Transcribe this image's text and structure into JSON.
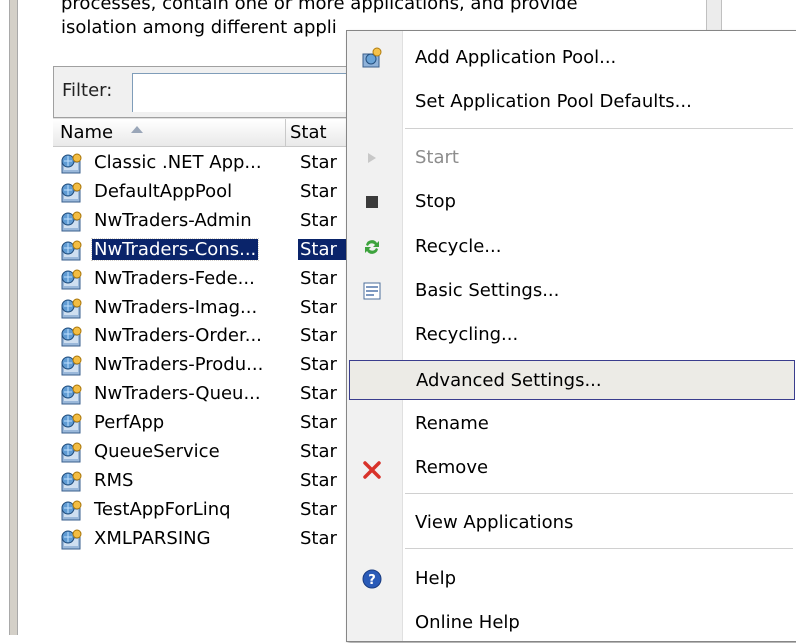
{
  "description": {
    "line1": "processes, contain one or more applications, and provide",
    "line2": "isolation among different appli"
  },
  "filter": {
    "label": "Filter:",
    "value": ""
  },
  "columns": {
    "name": "Name",
    "status": "Stat"
  },
  "pools": [
    {
      "name": "Classic .NET App...",
      "status": "Star"
    },
    {
      "name": "DefaultAppPool",
      "status": "Star"
    },
    {
      "name": "NwTraders-Admin",
      "status": "Star"
    },
    {
      "name": "NwTraders-Cons...",
      "status": "Star"
    },
    {
      "name": "NwTraders-Fede...",
      "status": "Star"
    },
    {
      "name": "NwTraders-Imag...",
      "status": "Star"
    },
    {
      "name": "NwTraders-Order...",
      "status": "Star"
    },
    {
      "name": "NwTraders-Produ...",
      "status": "Star"
    },
    {
      "name": "NwTraders-Queu...",
      "status": "Star"
    },
    {
      "name": "PerfApp",
      "status": "Star"
    },
    {
      "name": "QueueService",
      "status": "Star"
    },
    {
      "name": "RMS",
      "status": "Star"
    },
    {
      "name": "TestAppForLinq",
      "status": "Star"
    },
    {
      "name": "XMLPARSING",
      "status": "Star"
    }
  ],
  "context_menu": {
    "add_pool": "Add Application Pool...",
    "set_defaults": "Set Application Pool Defaults...",
    "start": "Start",
    "stop": "Stop",
    "recycle": "Recycle...",
    "basic_settings": "Basic Settings...",
    "recycling": "Recycling...",
    "advanced_settings": "Advanced Settings...",
    "rename": "Rename",
    "remove": "Remove",
    "view_applications": "View Applications",
    "help": "Help",
    "online_help": "Online Help"
  },
  "colors": {
    "selection": "#0a246a",
    "menu_highlight_border": "#3a3d8d",
    "remove_icon": "#d8322a",
    "help_icon": "#2a5bb8"
  }
}
